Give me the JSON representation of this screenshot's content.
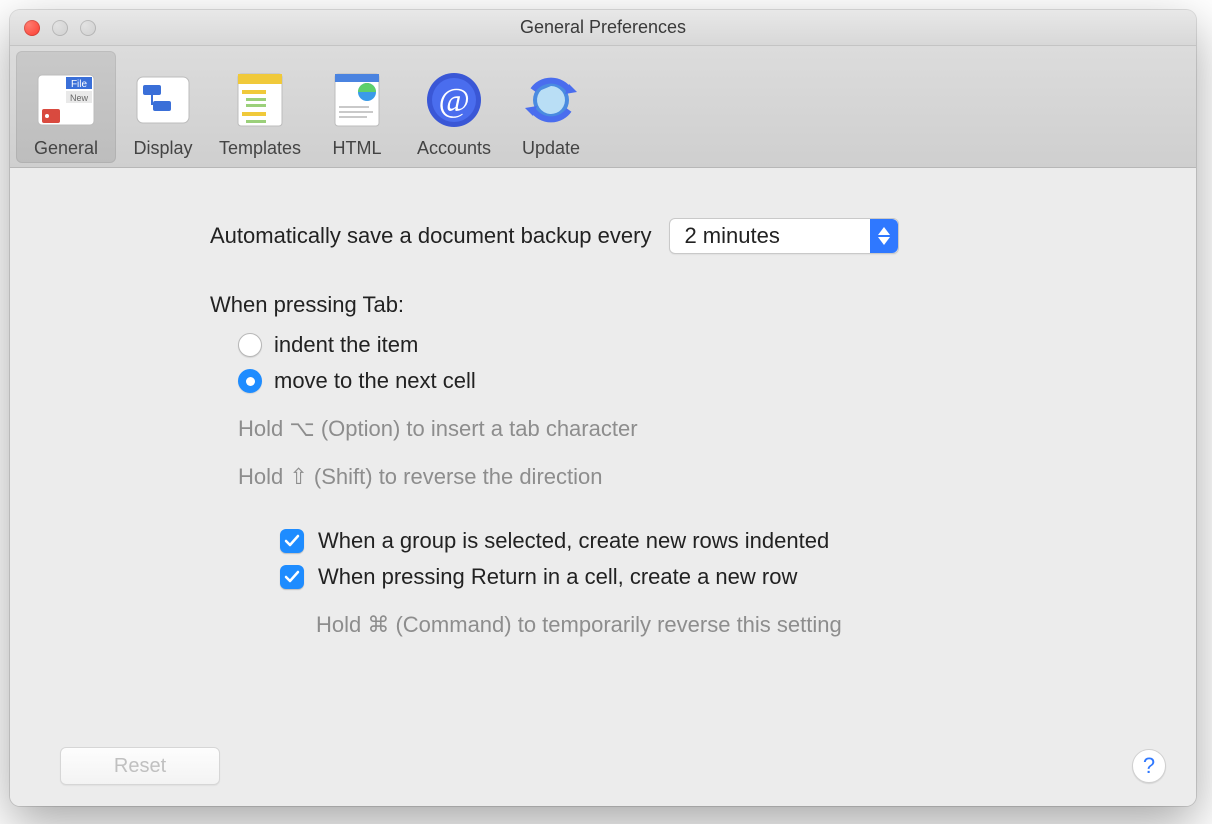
{
  "window": {
    "title": "General Preferences"
  },
  "toolbar": {
    "items": [
      {
        "label": "General",
        "selected": true
      },
      {
        "label": "Display",
        "selected": false
      },
      {
        "label": "Templates",
        "selected": false
      },
      {
        "label": "HTML",
        "selected": false
      },
      {
        "label": "Accounts",
        "selected": false
      },
      {
        "label": "Update",
        "selected": false
      }
    ]
  },
  "backup": {
    "label": "Automatically save a document backup every",
    "value": "2 minutes"
  },
  "tab_section": {
    "heading": "When pressing Tab:",
    "radio_indent": "indent the item",
    "radio_next": "move to the next cell",
    "hint_option": "Hold ⌥ (Option) to insert a tab character",
    "hint_shift": "Hold ⇧ (Shift) to reverse the direction"
  },
  "checks": {
    "group_rows": "When a group is selected, create new rows indented",
    "return_row": "When pressing Return in a cell, create a new row",
    "hint_cmd": "Hold ⌘ (Command) to temporarily reverse this setting"
  },
  "footer": {
    "reset": "Reset",
    "help": "?"
  }
}
